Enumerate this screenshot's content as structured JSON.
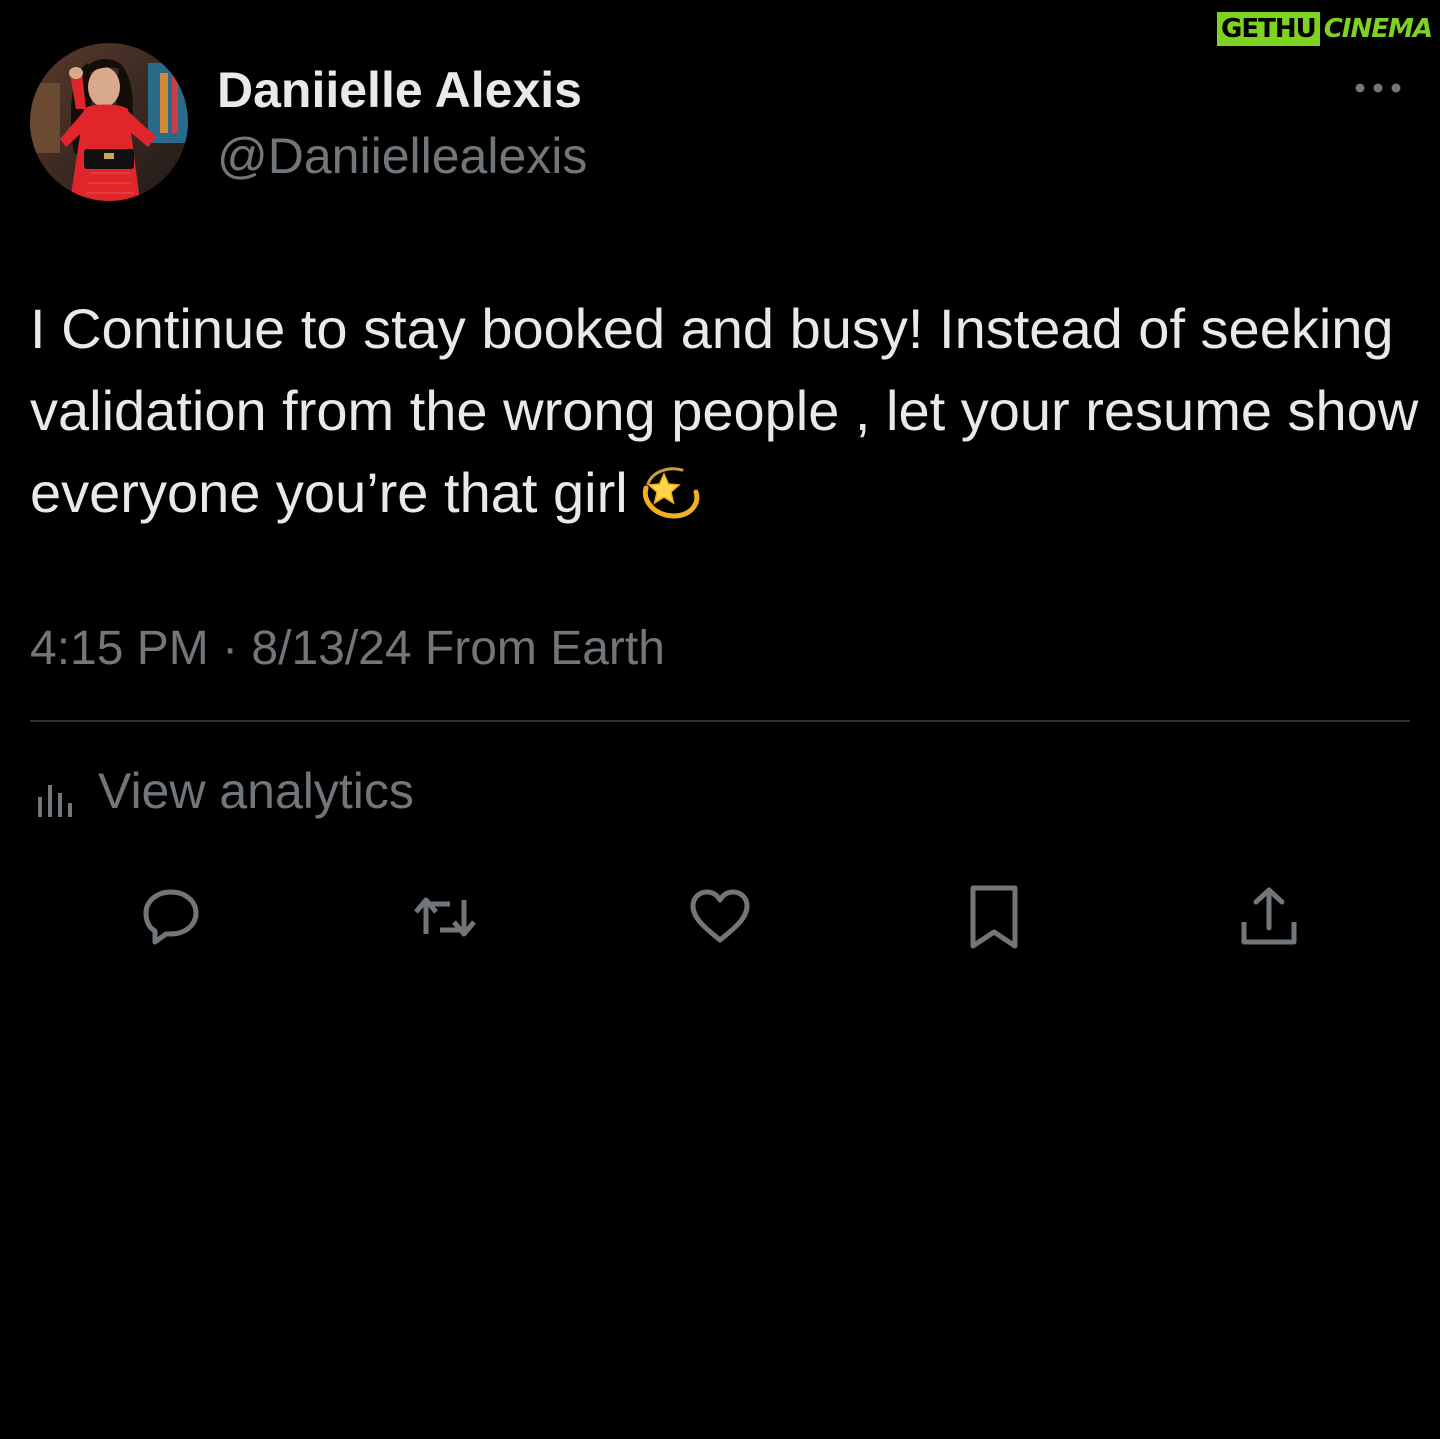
{
  "watermark": {
    "part1": "GETHU",
    "part2": "CINEMA"
  },
  "author": {
    "display_name": "Daniielle Alexis",
    "handle": "@Daniiellealexis",
    "avatar_icon": "avatar-photo"
  },
  "tweet": {
    "text": "I Continue to stay booked and busy!  Instead of seeking validation from the wrong people , let your resume show everyone you’re that girl",
    "emoji": "dizzy-star-emoji"
  },
  "meta": {
    "text": "4:15 PM · 8/13/24 From Earth"
  },
  "analytics": {
    "label": "View analytics",
    "icon": "bar-chart-icon"
  },
  "actions": [
    {
      "name": "reply",
      "icon": "speech-bubble-icon"
    },
    {
      "name": "retweet",
      "icon": "retweet-arrows-icon"
    },
    {
      "name": "like",
      "icon": "heart-icon"
    },
    {
      "name": "bookmark",
      "icon": "bookmark-icon"
    },
    {
      "name": "share",
      "icon": "share-arrow-icon"
    }
  ],
  "colors": {
    "background": "#000000",
    "primary_text": "#e7e9ea",
    "secondary_text": "#71767b",
    "divider": "#2f3336",
    "watermark_green": "#7ed321"
  }
}
